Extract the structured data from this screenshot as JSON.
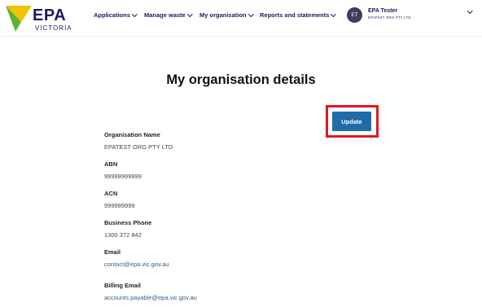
{
  "header": {
    "logo": {
      "brand": "EPA",
      "sub": "VICTORIA"
    },
    "nav": [
      {
        "label": "Applications"
      },
      {
        "label": "Manage waste"
      },
      {
        "label": "My organisation"
      },
      {
        "label": "Reports and statements"
      }
    ],
    "user": {
      "initials": "ET",
      "name": "EPA Tester",
      "org": "EPATEST ORG PTY LTD"
    }
  },
  "main": {
    "title": "My organisation details",
    "update_label": "Update",
    "fields": [
      {
        "label": "Organisation Name",
        "value": "EPATEST ORG PTY LTD"
      },
      {
        "label": "ABN",
        "value": "99999999999"
      },
      {
        "label": "ACN",
        "value": "999999999"
      },
      {
        "label": "Business Phone",
        "value": "1300 372 842"
      },
      {
        "label": "Email",
        "value": "contact@epa.vic.gov.au"
      },
      {
        "label": "Billing Email",
        "value": "accounts.payable@epa.vic.gov.au"
      }
    ]
  },
  "colors": {
    "primary_navy": "#1a1a5e",
    "button_blue": "#1f6ca8",
    "highlight_red": "#e21820",
    "logo_yellow": "#f3c300",
    "logo_green": "#5cb531",
    "logo_teal": "#1f9a8c"
  }
}
